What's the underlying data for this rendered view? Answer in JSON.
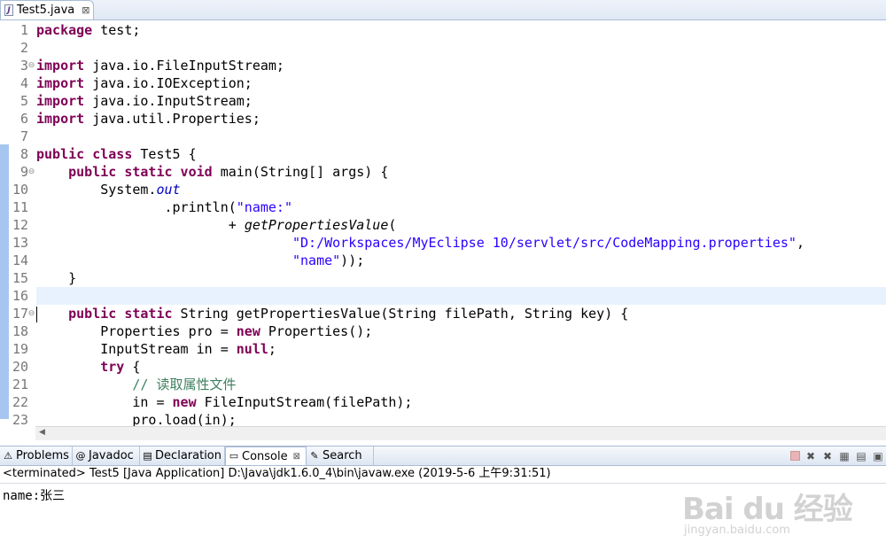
{
  "editor": {
    "tab": {
      "title": "Test5.java",
      "icon": "java-file-icon",
      "close": "⊠"
    },
    "lines": [
      {
        "n": "1",
        "fold": "",
        "current": false,
        "segs": [
          {
            "t": "package",
            "c": "kw"
          },
          {
            "t": " test;",
            "c": ""
          }
        ]
      },
      {
        "n": "2",
        "fold": "",
        "current": false,
        "segs": []
      },
      {
        "n": "3",
        "fold": "⊖",
        "current": false,
        "segs": [
          {
            "t": "import",
            "c": "kw"
          },
          {
            "t": " java.io.FileInputStream;",
            "c": ""
          }
        ]
      },
      {
        "n": "4",
        "fold": "",
        "current": false,
        "segs": [
          {
            "t": "import",
            "c": "kw"
          },
          {
            "t": " java.io.IOException;",
            "c": ""
          }
        ]
      },
      {
        "n": "5",
        "fold": "",
        "current": false,
        "segs": [
          {
            "t": "import",
            "c": "kw"
          },
          {
            "t": " java.io.InputStream;",
            "c": ""
          }
        ]
      },
      {
        "n": "6",
        "fold": "",
        "current": false,
        "segs": [
          {
            "t": "import",
            "c": "kw"
          },
          {
            "t": " java.util.Properties;",
            "c": ""
          }
        ]
      },
      {
        "n": "7",
        "fold": "",
        "current": false,
        "segs": []
      },
      {
        "n": "8",
        "fold": "",
        "current": false,
        "segs": [
          {
            "t": "public class",
            "c": "kw"
          },
          {
            "t": " Test5 {",
            "c": ""
          }
        ]
      },
      {
        "n": "9",
        "fold": "⊖",
        "current": false,
        "segs": [
          {
            "t": "    ",
            "c": ""
          },
          {
            "t": "public static void",
            "c": "kw"
          },
          {
            "t": " main(String[] args) {",
            "c": ""
          }
        ]
      },
      {
        "n": "10",
        "fold": "",
        "current": false,
        "segs": [
          {
            "t": "        System.",
            "c": ""
          },
          {
            "t": "out",
            "c": "fld"
          }
        ]
      },
      {
        "n": "11",
        "fold": "",
        "current": false,
        "segs": [
          {
            "t": "                .println(",
            "c": ""
          },
          {
            "t": "\"name:\"",
            "c": "str"
          }
        ]
      },
      {
        "n": "12",
        "fold": "",
        "current": false,
        "segs": [
          {
            "t": "                        + ",
            "c": ""
          },
          {
            "t": "getPropertiesValue",
            "c": "mth"
          },
          {
            "t": "(",
            "c": ""
          }
        ]
      },
      {
        "n": "13",
        "fold": "",
        "current": false,
        "segs": [
          {
            "t": "                                ",
            "c": ""
          },
          {
            "t": "\"D:/Workspaces/MyEclipse 10/servlet/src/CodeMapping.properties\"",
            "c": "str"
          },
          {
            "t": ",",
            "c": ""
          }
        ]
      },
      {
        "n": "14",
        "fold": "",
        "current": false,
        "segs": [
          {
            "t": "                                ",
            "c": ""
          },
          {
            "t": "\"name\"",
            "c": "str"
          },
          {
            "t": "));",
            "c": ""
          }
        ]
      },
      {
        "n": "15",
        "fold": "",
        "current": false,
        "segs": [
          {
            "t": "    }",
            "c": ""
          }
        ]
      },
      {
        "n": "16",
        "fold": "",
        "current": true,
        "segs": []
      },
      {
        "n": "17",
        "fold": "⊖",
        "current": false,
        "segs": [
          {
            "t": "    ",
            "c": ""
          },
          {
            "t": "public static",
            "c": "kw"
          },
          {
            "t": " String getPropertiesValue(String filePath, String key) {",
            "c": ""
          }
        ]
      },
      {
        "n": "18",
        "fold": "",
        "current": false,
        "segs": [
          {
            "t": "        Properties pro = ",
            "c": ""
          },
          {
            "t": "new",
            "c": "kw"
          },
          {
            "t": " Properties();",
            "c": ""
          }
        ]
      },
      {
        "n": "19",
        "fold": "",
        "current": false,
        "segs": [
          {
            "t": "        InputStream in = ",
            "c": ""
          },
          {
            "t": "null",
            "c": "kw"
          },
          {
            "t": ";",
            "c": ""
          }
        ]
      },
      {
        "n": "20",
        "fold": "",
        "current": false,
        "segs": [
          {
            "t": "        ",
            "c": ""
          },
          {
            "t": "try",
            "c": "kw"
          },
          {
            "t": " {",
            "c": ""
          }
        ]
      },
      {
        "n": "21",
        "fold": "",
        "current": false,
        "segs": [
          {
            "t": "            ",
            "c": ""
          },
          {
            "t": "// 读取属性文件",
            "c": "cmt"
          }
        ]
      },
      {
        "n": "22",
        "fold": "",
        "current": false,
        "segs": [
          {
            "t": "            in = ",
            "c": ""
          },
          {
            "t": "new",
            "c": "kw"
          },
          {
            "t": " FileInputStream(filePath);",
            "c": ""
          }
        ]
      },
      {
        "n": "23",
        "fold": "",
        "current": false,
        "segs": [
          {
            "t": "            pro.load(in);",
            "c": ""
          }
        ]
      }
    ]
  },
  "console": {
    "tabs": [
      {
        "label": "Problems",
        "icon": "problems-icon",
        "glyph": "⚠",
        "active": false
      },
      {
        "label": "Javadoc",
        "icon": "javadoc-icon",
        "glyph": "@",
        "active": false
      },
      {
        "label": "Declaration",
        "icon": "declaration-icon",
        "glyph": "▤",
        "active": false
      },
      {
        "label": "Console",
        "icon": "console-icon",
        "glyph": "▭",
        "active": true,
        "close": "⊠"
      },
      {
        "label": "Search",
        "icon": "search-icon",
        "glyph": "✎",
        "active": false
      }
    ],
    "toolbar": [
      {
        "name": "terminate-icon",
        "glyph": ""
      },
      {
        "name": "remove-launch-icon",
        "glyph": "✖"
      },
      {
        "name": "remove-all-icon",
        "glyph": "✖"
      },
      {
        "name": "clear-console-icon",
        "glyph": "▦"
      },
      {
        "name": "scroll-lock-icon",
        "glyph": "▤"
      },
      {
        "name": "pin-console-icon",
        "glyph": "▣"
      }
    ],
    "status": "<terminated> Test5 [Java Application] D:\\Java\\jdk1.6.0_4\\bin\\javaw.exe (2019-5-6 上午9:31:51)",
    "output": "name:张三"
  },
  "watermark": {
    "logo": "Bai du 经验",
    "url": "jingyan.baidu.com"
  }
}
